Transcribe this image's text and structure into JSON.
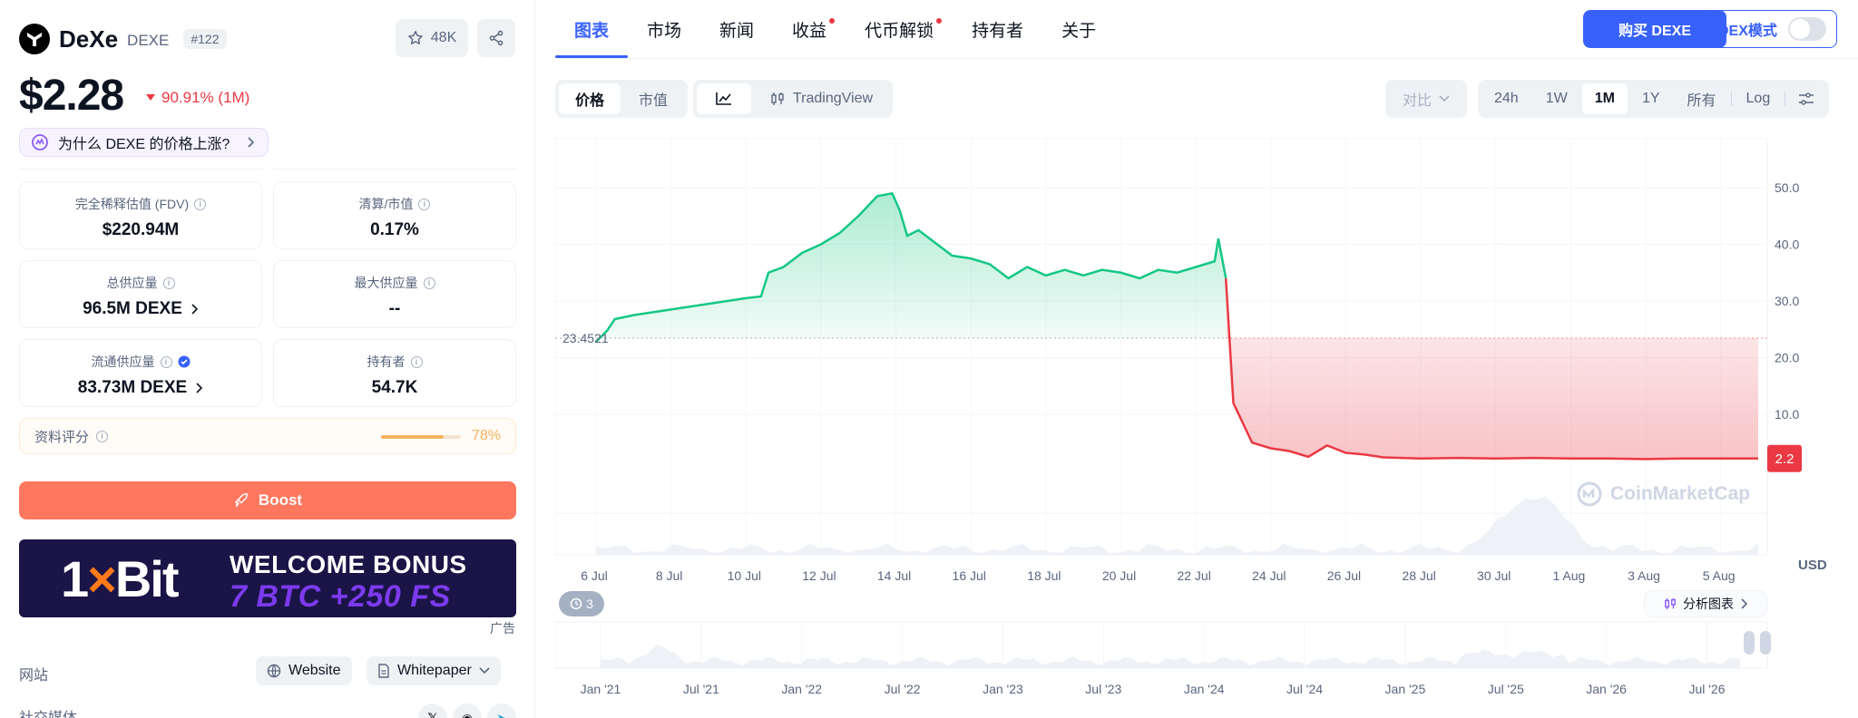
{
  "coin": {
    "name": "DeXe",
    "symbol": "DEXE",
    "rank": "#122",
    "watchlist_count": "48K"
  },
  "price": {
    "value": "$2.28",
    "change": "90.91% (1M)"
  },
  "why_prompt": "为什么 DEXE 的价格上涨?",
  "stats": [
    {
      "label": "完全稀释估值 (FDV)",
      "value": "$220.94M"
    },
    {
      "label": "清算/市值",
      "value": "0.17%"
    },
    {
      "label": "总供应量",
      "value": "96.5M DEXE"
    },
    {
      "label": "最大供应量",
      "value": "--"
    },
    {
      "label": "流通供应量",
      "value": "83.73M DEXE"
    },
    {
      "label": "持有者",
      "value": "54.7K"
    }
  ],
  "profile_score": {
    "label": "资料评分",
    "percent": "78%",
    "fill": 0.78
  },
  "boost_label": "Boost",
  "ad": {
    "brand_left": "1",
    "brand_x": "×",
    "brand_right": "Bit",
    "line1": "WELCOME BONUS",
    "line2": "7 BTC +250 FS",
    "label": "广告"
  },
  "links": {
    "website_label": "网站",
    "website": "Website",
    "whitepaper": "Whitepaper",
    "social_label": "社交媒体"
  },
  "tabs": [
    "图表",
    "市场",
    "新闻",
    "收益",
    "代币解锁",
    "持有者",
    "关于"
  ],
  "buy_button": "购买 DEXE",
  "dex_mode": "DEX模式",
  "chart_toolbar": {
    "type_tabs": [
      "价格",
      "市值"
    ],
    "view_tabs": [
      "TradingView"
    ],
    "compare": "对比",
    "ranges": [
      "24h",
      "1W",
      "1M",
      "1Y",
      "所有"
    ],
    "log": "Log",
    "active_range": "1M"
  },
  "chart_overlay": {
    "history_count": "3",
    "analysis": "分析图表",
    "watermark": "CoinMarketCap"
  },
  "colors": {
    "accent": "#3861fb",
    "up": "#16c784",
    "down": "#ea3943",
    "boost": "#ff775f"
  },
  "chart_data": {
    "type": "line",
    "title": "",
    "currency": "USD",
    "y_ticks": [
      10,
      20,
      30,
      40,
      50
    ],
    "y_tick_labels": [
      "10.0",
      "20.0",
      "30.0",
      "40.0",
      "50.0"
    ],
    "ylim": [
      -14.8,
      58.8
    ],
    "baseline": {
      "label": "23.4521",
      "value": 23.45
    },
    "current_price_label": "2.2",
    "x_tick_labels": [
      "6 Jul",
      "8 Jul",
      "10 Jul",
      "12 Jul",
      "14 Jul",
      "16 Jul",
      "18 Jul",
      "20 Jul",
      "22 Jul",
      "24 Jul",
      "26 Jul",
      "28 Jul",
      "30 Jul",
      "1 Aug",
      "3 Aug",
      "5 Aug"
    ],
    "x": [
      0,
      0.3,
      0.5,
      1,
      1.5,
      2,
      2.5,
      3,
      3.5,
      4,
      4.4,
      4.6,
      5,
      5.5,
      6,
      6.5,
      7,
      7.5,
      7.9,
      8.1,
      8.3,
      8.6,
      9,
      9.5,
      10,
      10.5,
      11,
      11.5,
      12,
      12.5,
      13,
      13.5,
      14,
      14.5,
      15,
      15.5,
      16,
      16.5,
      16.6,
      16.8,
      17,
      17.5,
      18,
      18.5,
      19,
      19.5,
      20,
      20.5,
      21,
      21.5,
      22,
      23,
      24,
      25,
      26,
      27,
      28,
      29,
      30,
      31
    ],
    "series": [
      {
        "values": [
          22.8,
          24.8,
          26.8,
          27.5,
          28,
          28.5,
          29,
          29.5,
          30,
          30.5,
          30.8,
          35,
          36,
          38.5,
          40,
          42,
          45,
          48.5,
          49,
          46,
          41.5,
          42.5,
          40.5,
          38,
          37.5,
          36.5,
          34,
          36,
          34.5,
          35.5,
          34.5,
          35.5,
          35,
          34,
          35.5,
          35,
          36,
          37,
          41,
          34,
          12,
          5,
          4,
          3.5,
          2.5,
          4.5,
          3.2,
          2.9,
          2.4,
          2.3,
          2.2,
          2.3,
          2.2,
          2.3,
          2.2,
          2.2,
          2.1,
          2.2,
          2.2,
          2.2
        ]
      }
    ],
    "navigator_x_labels": [
      "Jan '21",
      "Jul '21",
      "Jan '22",
      "Jul '22",
      "Jan '23",
      "Jul '23",
      "Jan '24",
      "Jul '24",
      "Jan '25",
      "Jul '25",
      "Jan '26",
      "Jul '26"
    ]
  }
}
